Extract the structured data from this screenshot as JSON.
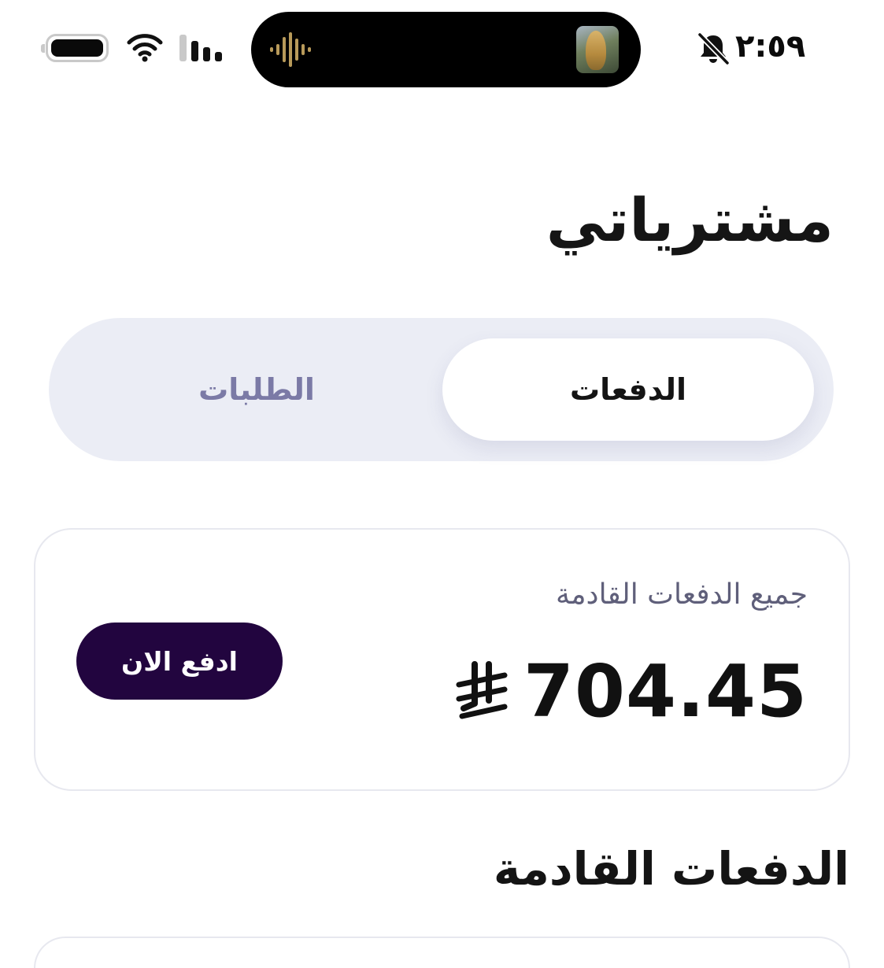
{
  "status_bar": {
    "time": "٢:٥٩",
    "icons": [
      "battery-icon",
      "wifi-icon",
      "cellular-signal-icon",
      "audio-waveform-icon",
      "bell-slash-icon"
    ],
    "accent_wave_color": "#b89a5a"
  },
  "page": {
    "title": "مشترياتي"
  },
  "tabs": {
    "active": "الدفعات",
    "inactive": "الطلبات"
  },
  "summary": {
    "label": "جميع الدفعات القادمة",
    "amount": "704.45",
    "currency_icon": "saudi-riyal-icon",
    "pay_button": "ادفع الان"
  },
  "section": {
    "title": "الدفعات القادمة"
  },
  "colors": {
    "primary_button": "#22053f",
    "segment_bg": "#ebedf5",
    "inactive_tab_text": "#7b7aa6",
    "muted_label": "#5f5f7a"
  }
}
